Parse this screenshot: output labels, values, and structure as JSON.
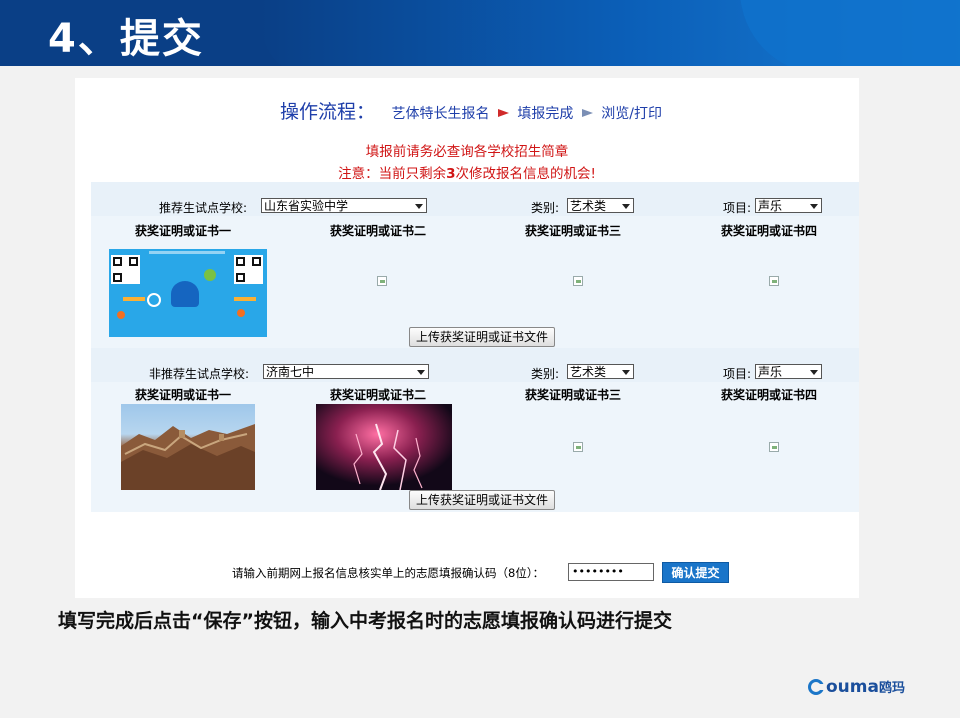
{
  "slide": {
    "title": "4、提交",
    "caption": "填写完成后点击“保存”按钮，输入中考报名时的志愿填报确认码进行提交"
  },
  "flow": {
    "label": "操作流程：",
    "steps": [
      "艺体特长生报名",
      "填报完成",
      "浏览/打印"
    ]
  },
  "notice": {
    "line1": "填报前请务必查询各学校招生简章",
    "line2_prefix": "注意：当前只剩余",
    "line2_count": "3",
    "line2_suffix": "次修改报名信息的机会!"
  },
  "sections": [
    {
      "school_label": "推荐生试点学校:",
      "school_value": "山东省实验中学",
      "category_label": "类别:",
      "category_value": "艺术类",
      "item_label": "项目:",
      "item_value": "声乐",
      "certs": [
        "获奖证明或证书一",
        "获奖证明或证书二",
        "获奖证明或证书三",
        "获奖证明或证书四"
      ],
      "upload_label": "上传获奖证明或证书文件"
    },
    {
      "school_label": "非推荐生试点学校:",
      "school_value": "济南七中",
      "category_label": "类别:",
      "category_value": "艺术类",
      "item_label": "项目:",
      "item_value": "声乐",
      "certs": [
        "获奖证明或证书一",
        "获奖证明或证书二",
        "获奖证明或证书三",
        "获奖证明或证书四"
      ],
      "upload_label": "上传获奖证明或证书文件"
    }
  ],
  "confirm": {
    "prompt": "请输入前期网上报名信息核实单上的志愿填报确认码（8位）：",
    "input_value": "••••••••",
    "submit_label": "确认提交"
  },
  "logo": {
    "text": "ouma",
    "cn": "鸥玛"
  },
  "colors": {
    "header": "#0a3f86",
    "accent": "#1a75c9",
    "notice_red": "#d01515",
    "flow_blue": "#1f3faa"
  }
}
